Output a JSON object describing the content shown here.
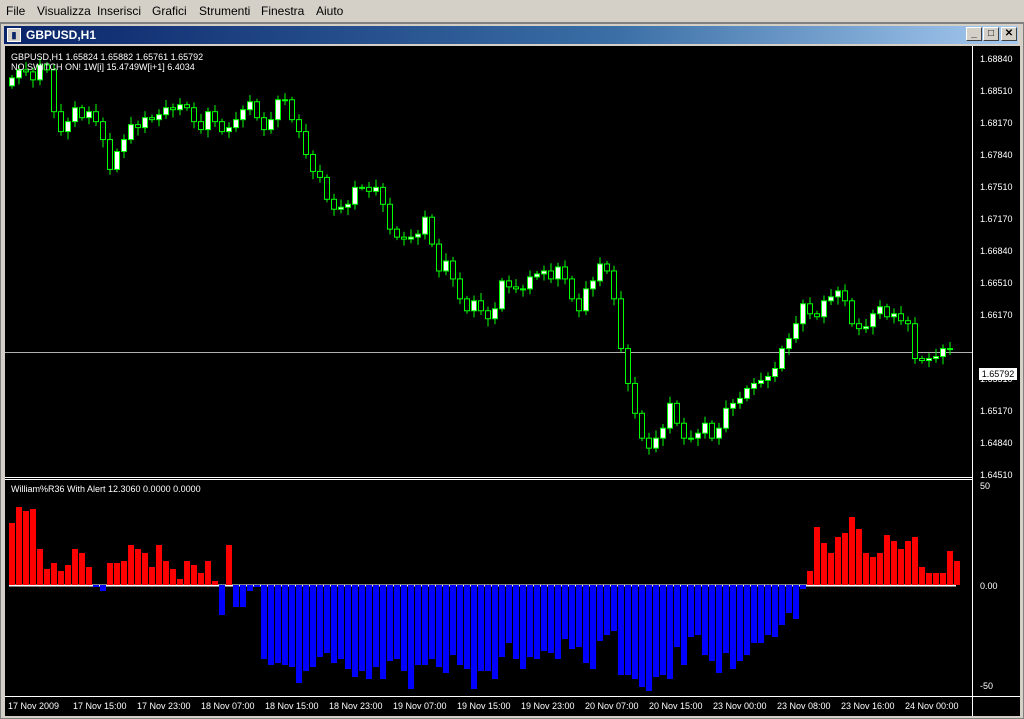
{
  "menu": [
    "File",
    "Visualizza",
    "Inserisci",
    "Grafici",
    "Strumenti",
    "Finestra",
    "Aiuto"
  ],
  "window": {
    "title": "GBPUSD,H1",
    "minimize": "_",
    "restore": "□",
    "close": "✕"
  },
  "chart": {
    "info_line1": "GBPUSD,H1  1.65824 1.65882 1.65761 1.65792",
    "info_line2": "NO SWITCH ON! 1W[i] 15.4749W[i+1] 6.4034",
    "current_price": "1.65792",
    "price_ticks": [
      "1.68840",
      "1.68510",
      "1.68170",
      "1.67840",
      "1.67510",
      "1.67170",
      "1.66840",
      "1.66510",
      "1.66170",
      "1.65510",
      "1.65170",
      "1.64840",
      "1.64510"
    ],
    "indicator_label": "William%R36 With Alert 12.3060 0.0000 0.0000",
    "osc_ticks": [
      "50",
      "0.00",
      "-50"
    ],
    "time_labels": [
      "17 Nov 2009",
      "17 Nov 15:00",
      "17 Nov 23:00",
      "18 Nov 07:00",
      "18 Nov 15:00",
      "18 Nov 23:00",
      "19 Nov 07:00",
      "19 Nov 15:00",
      "19 Nov 23:00",
      "20 Nov 07:00",
      "20 Nov 15:00",
      "23 Nov 00:00",
      "23 Nov 08:00",
      "23 Nov 16:00",
      "24 Nov 00:00"
    ],
    "colors": {
      "bull": "#ffffff",
      "wick": "#00ff00",
      "positive": "#ff0000",
      "negative": "#0000ff"
    }
  },
  "chart_data": [
    {
      "type": "candlestick",
      "symbol": "GBPUSD",
      "timeframe": "H1",
      "ylim": [
        1.6451,
        1.6884
      ],
      "closes": [
        1.6852,
        1.686,
        1.6858,
        1.685,
        1.6865,
        1.686,
        1.6818,
        1.6798,
        1.6808,
        1.6822,
        1.6812,
        1.6818,
        1.6808,
        1.679,
        1.676,
        1.6778,
        1.679,
        1.6805,
        1.6802,
        1.6812,
        1.681,
        1.6815,
        1.6822,
        1.682,
        1.6825,
        1.6822,
        1.6808,
        1.68,
        1.6818,
        1.6808,
        1.6798,
        1.6802,
        1.681,
        1.682,
        1.6828,
        1.6812,
        1.68,
        1.681,
        1.683,
        1.683,
        1.681,
        1.6798,
        1.6775,
        1.6758,
        1.6752,
        1.673,
        1.672,
        1.6722,
        1.6725,
        1.6742,
        1.6742,
        1.6738,
        1.6742,
        1.6725,
        1.67,
        1.6692,
        1.669,
        1.6692,
        1.6695,
        1.6712,
        1.6685,
        1.6658,
        1.6668,
        1.665,
        1.663,
        1.6618,
        1.6628,
        1.6618,
        1.661,
        1.662,
        1.6648,
        1.6642,
        1.664,
        1.664,
        1.6652,
        1.6655,
        1.6658,
        1.665,
        1.6662,
        1.665,
        1.663,
        1.6618,
        1.664,
        1.6648,
        1.6665,
        1.6658,
        1.663,
        1.658,
        1.6545,
        1.6515,
        1.649,
        1.648,
        1.649,
        1.65,
        1.6525,
        1.6505,
        1.649,
        1.649,
        1.6495,
        1.6505,
        1.649,
        1.65,
        1.652,
        1.6525,
        1.653,
        1.654,
        1.6545,
        1.6548,
        1.6552,
        1.656,
        1.658,
        1.659,
        1.6605,
        1.6625,
        1.6615,
        1.6612,
        1.6628,
        1.6632,
        1.6638,
        1.6628,
        1.6605,
        1.66,
        1.6602,
        1.6615,
        1.6622,
        1.6612,
        1.6615,
        1.6608,
        1.6605,
        1.657,
        1.6568,
        1.657,
        1.6572,
        1.658,
        1.6579
      ]
    },
    {
      "type": "bar",
      "title": "William%R36 With Alert",
      "ylim": [
        -50,
        50
      ],
      "values": [
        31,
        39,
        37,
        38,
        18,
        8,
        11,
        7,
        10,
        18,
        16,
        9,
        -1,
        -3,
        11,
        11,
        12,
        20,
        18,
        16,
        9,
        20,
        12,
        8,
        3,
        12,
        10,
        6,
        12,
        2,
        -15,
        20,
        -11,
        -11,
        -3,
        -1,
        -37,
        -40,
        -39,
        -40,
        -41,
        -49,
        -43,
        -41,
        -36,
        -34,
        -39,
        -37,
        -42,
        -46,
        -43,
        -47,
        -41,
        -47,
        -38,
        -37,
        -43,
        -52,
        -40,
        -40,
        -37,
        -41,
        -44,
        -35,
        -40,
        -42,
        -52,
        -43,
        -43,
        -47,
        -36,
        -29,
        -37,
        -42,
        -36,
        -37,
        -33,
        -34,
        -37,
        -27,
        -32,
        -31,
        -39,
        -42,
        -28,
        -25,
        -23,
        -45,
        -45,
        -47,
        -51,
        -53,
        -46,
        -45,
        -47,
        -31,
        -40,
        -26,
        -25,
        -35,
        -38,
        -44,
        -34,
        -42,
        -38,
        -35,
        -29,
        -29,
        -25,
        -26,
        -20,
        -14,
        -17,
        -2,
        7,
        29,
        21,
        16,
        24,
        26,
        34,
        28,
        16,
        14,
        16,
        25,
        22,
        18,
        22,
        24,
        9,
        6,
        6,
        6,
        17,
        12
      ]
    }
  ]
}
